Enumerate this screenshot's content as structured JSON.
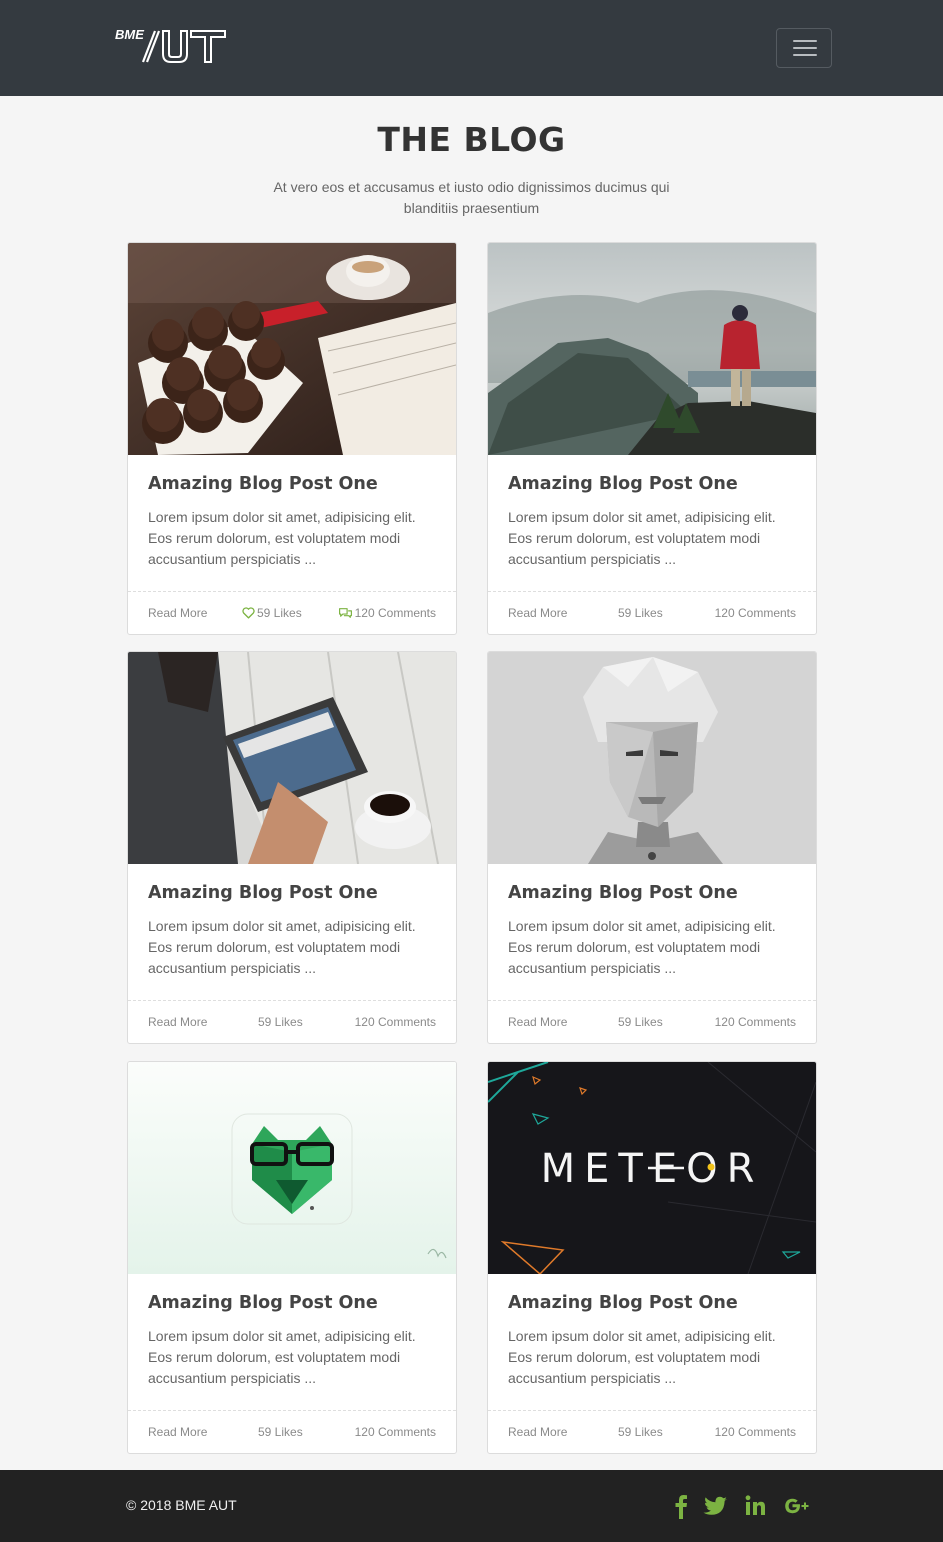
{
  "header": {
    "logo_text": "BME AUT",
    "menu_toggle_icon": "hamburger-icon"
  },
  "main": {
    "title": "THE BLOG",
    "subtitle": "At vero eos et accusamus et iusto odio dignissimos ducimus qui blanditiis praesentium"
  },
  "posts": [
    {
      "image": "muffins-coffee-book",
      "title": "Amazing Blog Post One",
      "excerpt": "Lorem ipsum dolor sit amet, adipisicing elit. Eos rerum dolorum, est voluptatem modi accusantium perspiciatis ...",
      "read_more": "Read More",
      "likes": "59 Likes",
      "comments": "120 Comments"
    },
    {
      "image": "hiker-mountain",
      "title": "Amazing Blog Post One",
      "excerpt": "Lorem ipsum dolor sit amet, adipisicing elit. Eos rerum dolorum, est voluptatem modi accusantium perspiciatis ...",
      "read_more": "Read More",
      "likes": "59 Likes",
      "comments": "120 Comments"
    },
    {
      "image": "tablet-coffee",
      "title": "Amazing Blog Post One",
      "excerpt": "Lorem ipsum dolor sit amet, adipisicing elit. Eos rerum dolorum, est voluptatem modi accusantium perspiciatis ...",
      "read_more": "Read More",
      "likes": "59 Likes",
      "comments": "120 Comments"
    },
    {
      "image": "lowpoly-portrait",
      "title": "Amazing Blog Post One",
      "excerpt": "Lorem ipsum dolor sit amet, adipisicing elit. Eos rerum dolorum, est voluptatem modi accusantium perspiciatis ...",
      "read_more": "Read More",
      "likes": "59 Likes",
      "comments": "120 Comments"
    },
    {
      "image": "geometric-bear-logo",
      "title": "Amazing Blog Post One",
      "excerpt": "Lorem ipsum dolor sit amet, adipisicing elit. Eos rerum dolorum, est voluptatem modi accusantium perspiciatis ...",
      "read_more": "Read More",
      "likes": "59 Likes",
      "comments": "120 Comments"
    },
    {
      "image": "meteor-logo",
      "image_text": "METEOR",
      "title": "Amazing Blog Post One",
      "excerpt": "Lorem ipsum dolor sit amet, adipisicing elit. Eos rerum dolorum, est voluptatem modi accusantium perspiciatis ...",
      "read_more": "Read More",
      "likes": "59 Likes",
      "comments": "120 Comments"
    }
  ],
  "footer": {
    "copyright": "© 2018 BME AUT",
    "social": [
      "facebook-icon",
      "twitter-icon",
      "linkedin-icon",
      "google-plus-icon"
    ]
  },
  "colors": {
    "navbar": "#343a40",
    "footer": "#222222",
    "accent_green": "#7cb342",
    "background": "#f5f5f5"
  }
}
